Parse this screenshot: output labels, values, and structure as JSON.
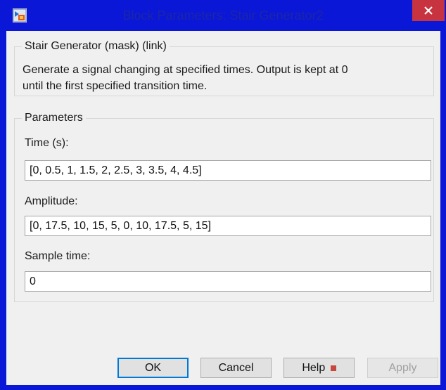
{
  "window": {
    "title": "Block Parameters: Stair Generator2",
    "icons": {
      "app": "simulink-block-icon",
      "close": "close-icon",
      "help_marker": "help-marker-icon"
    },
    "colors": {
      "titlebar": "#0b17d6",
      "title_text": "#1c26a8",
      "close": "#c7333f",
      "client": "#f0f0f0"
    }
  },
  "mask": {
    "group_title": "Stair Generator (mask) (link)",
    "description_line1": "Generate a signal changing at specified times. Output is kept at 0",
    "description_line2": "until the first specified transition time."
  },
  "parameters": {
    "group_title": "Parameters",
    "time": {
      "label": "Time (s):",
      "value": "[0, 0.5, 1, 1.5, 2, 2.5, 3, 3.5, 4, 4.5]"
    },
    "amplitude": {
      "label": "Amplitude:",
      "value": "[0, 17.5, 10, 15, 5, 0, 10, 17.5, 5, 15]"
    },
    "sample_time": {
      "label": "Sample time:",
      "value": "0"
    }
  },
  "buttons": {
    "ok": "OK",
    "cancel": "Cancel",
    "help": "Help",
    "apply": "Apply"
  }
}
